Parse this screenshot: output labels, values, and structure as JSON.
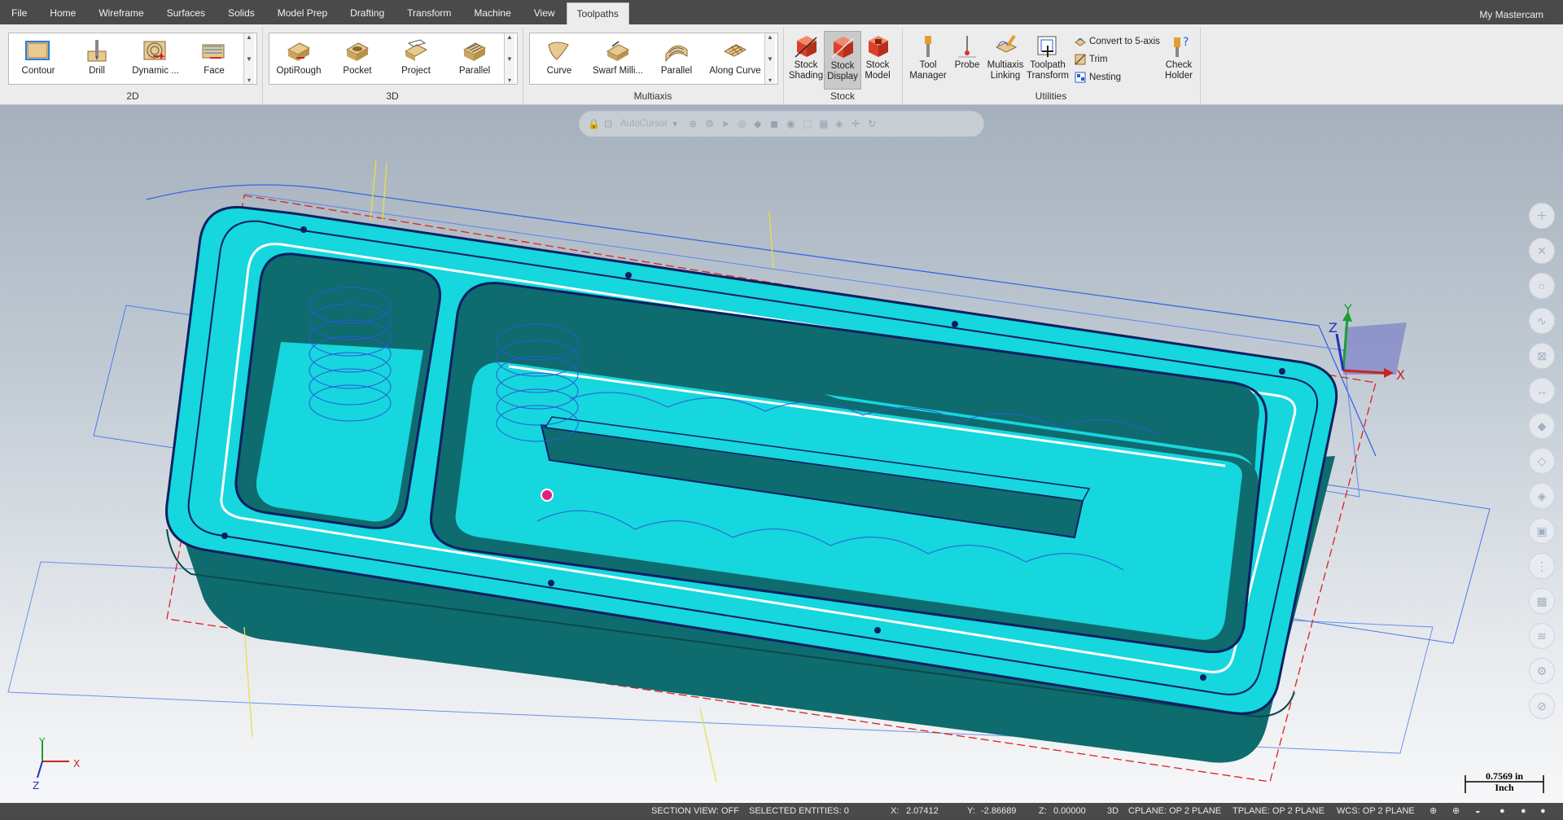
{
  "menu": {
    "tabs": [
      "File",
      "Home",
      "Wireframe",
      "Surfaces",
      "Solids",
      "Model Prep",
      "Drafting",
      "Transform",
      "Machine",
      "View",
      "Toolpaths"
    ],
    "active_tab": "Toolpaths",
    "account": "My Mastercam"
  },
  "ribbon": {
    "group_2d": {
      "label": "2D",
      "buttons": [
        "Contour",
        "Drill",
        "Dynamic ...",
        "Face"
      ]
    },
    "group_3d": {
      "label": "3D",
      "buttons": [
        "OptiRough",
        "Pocket",
        "Project",
        "Parallel"
      ]
    },
    "group_multiaxis": {
      "label": "Multiaxis",
      "buttons": [
        "Curve",
        "Swarf Milli...",
        "Parallel",
        "Along Curve"
      ]
    },
    "group_stock": {
      "label": "Stock",
      "buttons": [
        "Stock\nShading",
        "Stock\nDisplay",
        "Stock\nModel"
      ]
    },
    "group_utilities": {
      "label": "Utilities",
      "buttons": [
        "Tool\nManager",
        "Probe",
        "Multiaxis\nLinking",
        "Toolpath\nTransform",
        "Check\nHolder"
      ],
      "small_buttons": [
        "Convert to 5-axis",
        "Trim",
        "Nesting"
      ]
    }
  },
  "viewport": {
    "autocursor_label": "AutoCursor",
    "gnomon": {
      "x": "X",
      "y": "Y",
      "z": "Z"
    },
    "corner_axes": {
      "x": "X",
      "y": "Y",
      "z": "Z"
    },
    "scale": {
      "value": "0.7569 in",
      "unit": "Inch"
    }
  },
  "status": {
    "section_view": "SECTION VIEW: OFF",
    "selected": "SELECTED ENTITIES: 0",
    "x_label": "X:",
    "x_val": "2.07412",
    "y_label": "Y:",
    "y_val": "-2.86689",
    "z_label": "Z:",
    "z_val": "0.00000",
    "mode": "3D",
    "cplane": "CPLANE: OP 2 PLANE",
    "tplane": "TPLANE: OP 2 PLANE",
    "wcs": "WCS: OP 2 PLANE"
  },
  "colors": {
    "part_top": "#16d6de",
    "part_side": "#0e6b6e",
    "toolpath": "#2a5bd8",
    "stock_boundary": "#e02a2a",
    "viewport_top": "#a4b0bc"
  }
}
